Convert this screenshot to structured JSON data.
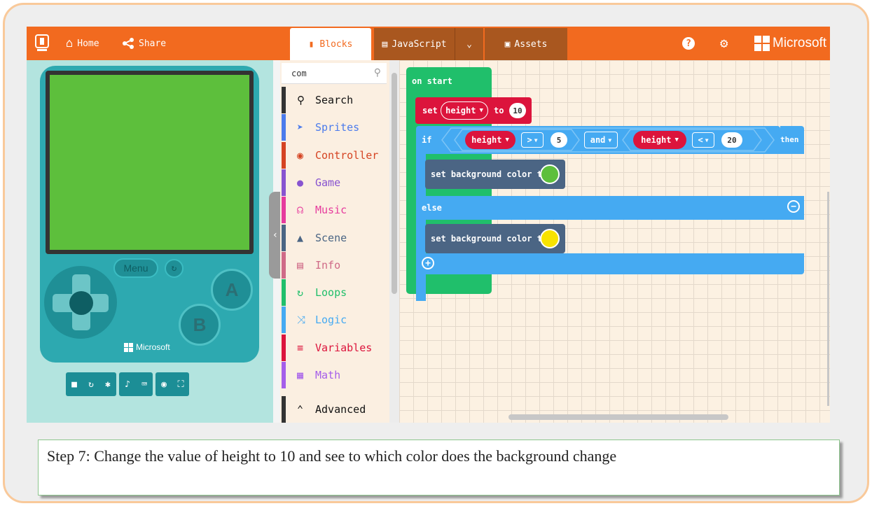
{
  "topbar": {
    "home_label": "Home",
    "share_label": "Share",
    "brand_label": "Microsoft",
    "tabs": [
      {
        "label": "Blocks",
        "active": true
      },
      {
        "label": "JavaScript",
        "active": false
      },
      {
        "label": "Assets",
        "active": false
      }
    ]
  },
  "simulator": {
    "screen_color": "#5dbf3c",
    "menu_label": "Menu",
    "a_label": "A",
    "b_label": "B",
    "brand_label": "Microsoft"
  },
  "toolbox": {
    "search_value": "com",
    "categories": [
      {
        "label": "Search",
        "color": "#000000",
        "icon": "search-icon"
      },
      {
        "label": "Sprites",
        "color": "#4b7bec",
        "icon": "paper-plane-icon"
      },
      {
        "label": "Controller",
        "color": "#d54322",
        "icon": "gamepad-icon"
      },
      {
        "label": "Game",
        "color": "#8854d0",
        "icon": "circle-icon"
      },
      {
        "label": "Music",
        "color": "#e63b9d",
        "icon": "headphones-icon"
      },
      {
        "label": "Scene",
        "color": "#4b6584",
        "icon": "tree-icon"
      },
      {
        "label": "Info",
        "color": "#cf6a87",
        "icon": "id-card-icon"
      },
      {
        "label": "Loops",
        "color": "#20bf6b",
        "icon": "loop-icon"
      },
      {
        "label": "Logic",
        "color": "#45aaf2",
        "icon": "shuffle-icon"
      },
      {
        "label": "Variables",
        "color": "#dc143c",
        "icon": "list-icon"
      },
      {
        "label": "Math",
        "color": "#a55eea",
        "icon": "calculator-icon"
      },
      {
        "label": "Advanced",
        "color": "#333333",
        "icon": "chevron-up-icon"
      }
    ]
  },
  "blocks": {
    "on_start": "on start",
    "set_label": "set",
    "var_name": "height",
    "to_label": "to",
    "set_value": "10",
    "if_label": "if",
    "gt_op": ">",
    "cond1_value": "5",
    "and_label": "and",
    "lt_op": "<",
    "cond2_value": "20",
    "then_label": "then",
    "set_bg_label": "set background color to",
    "else_label": "else",
    "color_then": "#5dbf3c",
    "color_else": "#f7e300"
  },
  "caption": {
    "text": "Step 7: Change the value of height to 10 and see to which color does the background change"
  }
}
